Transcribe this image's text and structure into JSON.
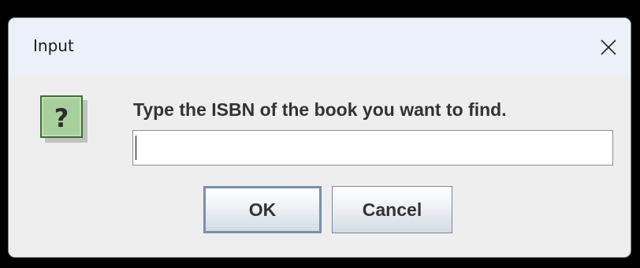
{
  "window": {
    "title": "Input",
    "close_glyph": "✕"
  },
  "dialog": {
    "icon": "question-icon",
    "icon_glyph": "?",
    "icon_color": "#a7cf9b",
    "prompt": "Type the ISBN of the book you want to find.",
    "input_value": "",
    "ok_label": "OK",
    "cancel_label": "Cancel"
  }
}
